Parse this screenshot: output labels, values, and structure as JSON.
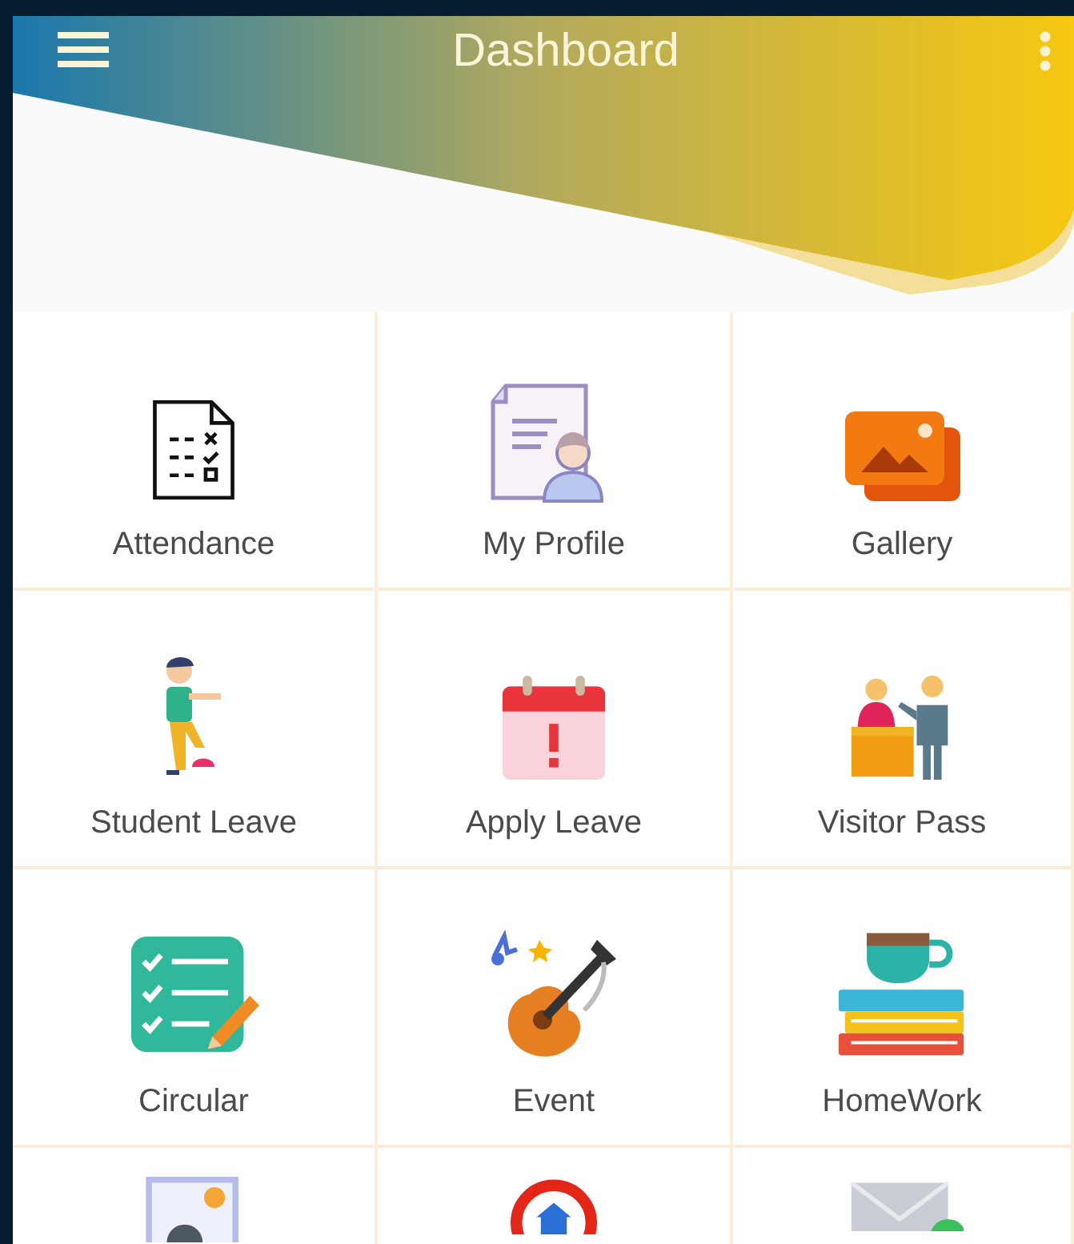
{
  "app_bar": {
    "title": "Dashboard"
  },
  "tiles": [
    {
      "kind": "full",
      "label": "Attendance"
    },
    {
      "kind": "full",
      "label": "My Profile"
    },
    {
      "kind": "full",
      "label": "Gallery"
    },
    {
      "kind": "full",
      "label": "Student Leave"
    },
    {
      "kind": "full",
      "label": "Apply Leave"
    },
    {
      "kind": "full",
      "label": "Visitor Pass"
    },
    {
      "kind": "full",
      "label": "Circular"
    },
    {
      "kind": "full",
      "label": "Event"
    },
    {
      "kind": "full",
      "label": "HomeWork"
    },
    {
      "kind": "cut"
    },
    {
      "kind": "cut"
    },
    {
      "kind": "cut"
    }
  ]
}
